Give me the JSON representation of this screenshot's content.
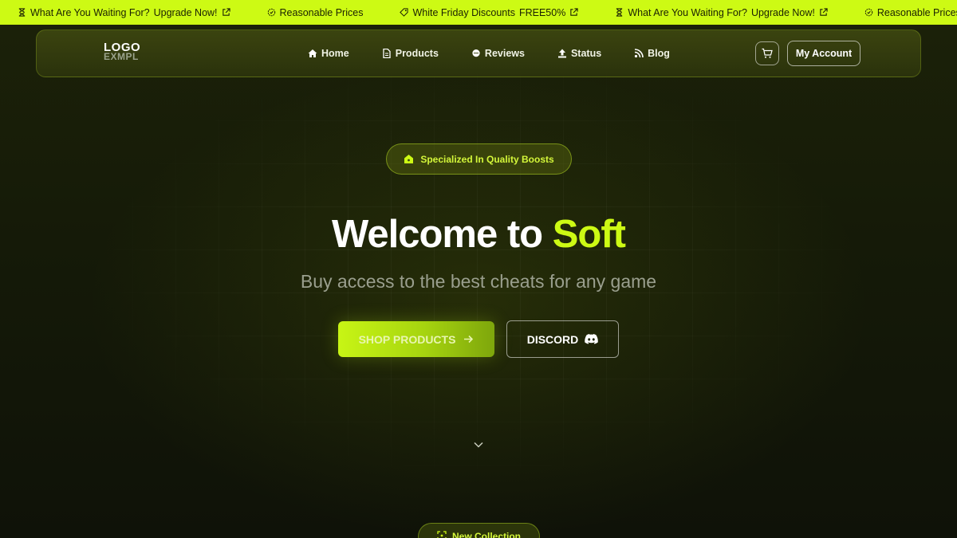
{
  "ticker": {
    "items": [
      {
        "icon": "hourglass-icon",
        "text": "What Are You Waiting For?",
        "strong": "Upgrade Now!",
        "link_icon": true
      },
      {
        "icon": "badge-check-icon",
        "text": "Reasonable Prices",
        "strong": "",
        "link_icon": false
      },
      {
        "icon": "tag-icon",
        "text": "White Friday Discounts",
        "strong": "FREE50%",
        "link_icon": true
      },
      {
        "icon": "hourglass-icon",
        "text": "What Are You Waiting For?",
        "strong": "Upgrade Now!",
        "link_icon": true
      },
      {
        "icon": "badge-check-icon",
        "text": "Reasonable Prices",
        "strong": "",
        "link_icon": false
      }
    ]
  },
  "nav": {
    "logo_top": "LOGO",
    "logo_bottom": "EXMPL",
    "links": [
      {
        "label": "Home",
        "icon": "home-icon"
      },
      {
        "label": "Products",
        "icon": "document-icon"
      },
      {
        "label": "Reviews",
        "icon": "chat-icon"
      },
      {
        "label": "Status",
        "icon": "upload-icon"
      },
      {
        "label": "Blog",
        "icon": "rss-icon"
      }
    ],
    "account_label": "My Account"
  },
  "hero": {
    "badge": "Specialized In Quality Boosts",
    "headline_main": "Welcome to",
    "headline_accent": "Soft",
    "subline": "Buy access to the best cheats for any game",
    "shop_label": "SHOP PRODUCTS",
    "discord_label": "DISCORD"
  },
  "collection": {
    "label": "New Collection"
  },
  "colors": {
    "accent": "#cdfa14",
    "background": "#0f1208"
  }
}
